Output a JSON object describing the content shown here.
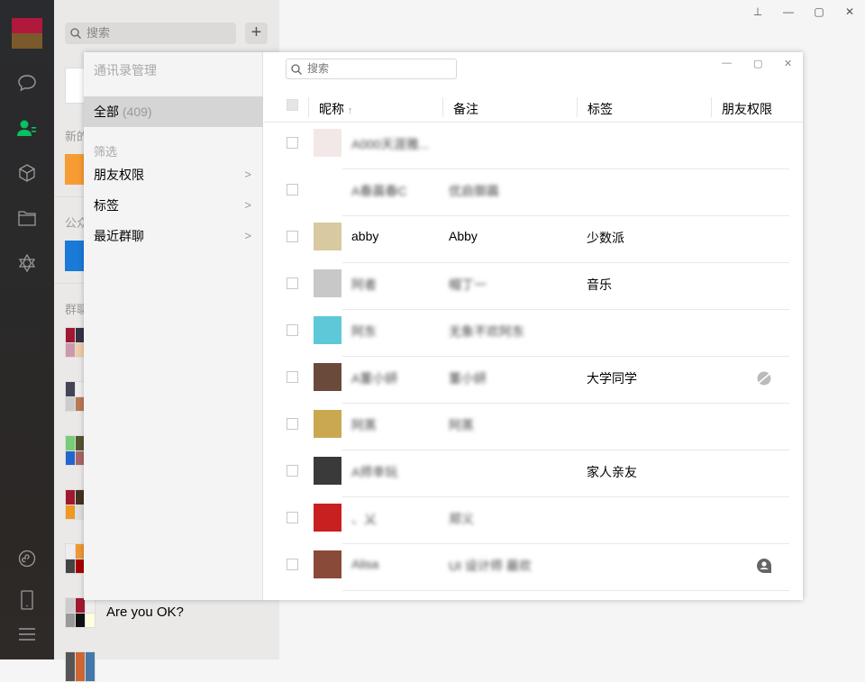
{
  "window": {
    "pin": "⊥",
    "minimize": "—",
    "maximize": "▢",
    "close": "✕"
  },
  "mid": {
    "search_placeholder": "搜索",
    "add": "+",
    "sections": {
      "new": "新的",
      "official": "公众",
      "groups": "群聊"
    },
    "group_chat_name": "Are you OK?"
  },
  "dialog": {
    "title": "通讯录管理",
    "all_label": "全部",
    "all_count": "(409)",
    "filter_label": "筛选",
    "filters": [
      {
        "label": "朋友权限"
      },
      {
        "label": "标签"
      },
      {
        "label": "最近群聊"
      }
    ],
    "search_placeholder": "搜索",
    "columns": {
      "nickname": "昵称",
      "sort": "↑",
      "remark": "备注",
      "tag": "标签",
      "permission": "朋友权限"
    },
    "rows": [
      {
        "name": "A000天涯雅...",
        "remark": "",
        "tag": "",
        "perm": "",
        "blurred": true,
        "avatar": "#f3e8e8"
      },
      {
        "name": "A春晨春C",
        "remark": "优启御晨",
        "tag": "",
        "perm": "",
        "blurred": true,
        "avatar": "#ffffff"
      },
      {
        "name": "abby",
        "remark": "Abby",
        "tag": "少数派",
        "perm": "",
        "blurred": false,
        "avatar": "#d8c9a0"
      },
      {
        "name": "阿者",
        "remark": "帽丁一",
        "tag": "音乐",
        "perm": "",
        "blurred": true,
        "avatar": "#c8c8c8"
      },
      {
        "name": "阿东",
        "remark": "无象不欢阿东",
        "tag": "",
        "perm": "",
        "blurred": true,
        "avatar": "#5ec8d8"
      },
      {
        "name": "A董小妍",
        "remark": "董小妍",
        "tag": "大学同学",
        "perm": "hide-moments",
        "blurred": true,
        "avatar": "#6a4a3a"
      },
      {
        "name": "阿蒸",
        "remark": "阿蒸",
        "tag": "",
        "perm": "",
        "blurred": true,
        "avatar": "#c9a850"
      },
      {
        "name": "A师幸玩",
        "remark": "",
        "tag": "家人亲友",
        "perm": "",
        "blurred": true,
        "avatar": "#3a3a3a"
      },
      {
        "name": "、乂",
        "remark": "郑义",
        "tag": "",
        "perm": "",
        "blurred": true,
        "avatar": "#c82020"
      },
      {
        "name": "Alisa",
        "remark": "UI 设计师 最欢",
        "tag": "",
        "perm": "chat-only",
        "blurred": true,
        "avatar": "#8a4a3a"
      }
    ]
  },
  "colors": {
    "accent": "#07c160",
    "nav_bg": "#2b2b2d"
  }
}
